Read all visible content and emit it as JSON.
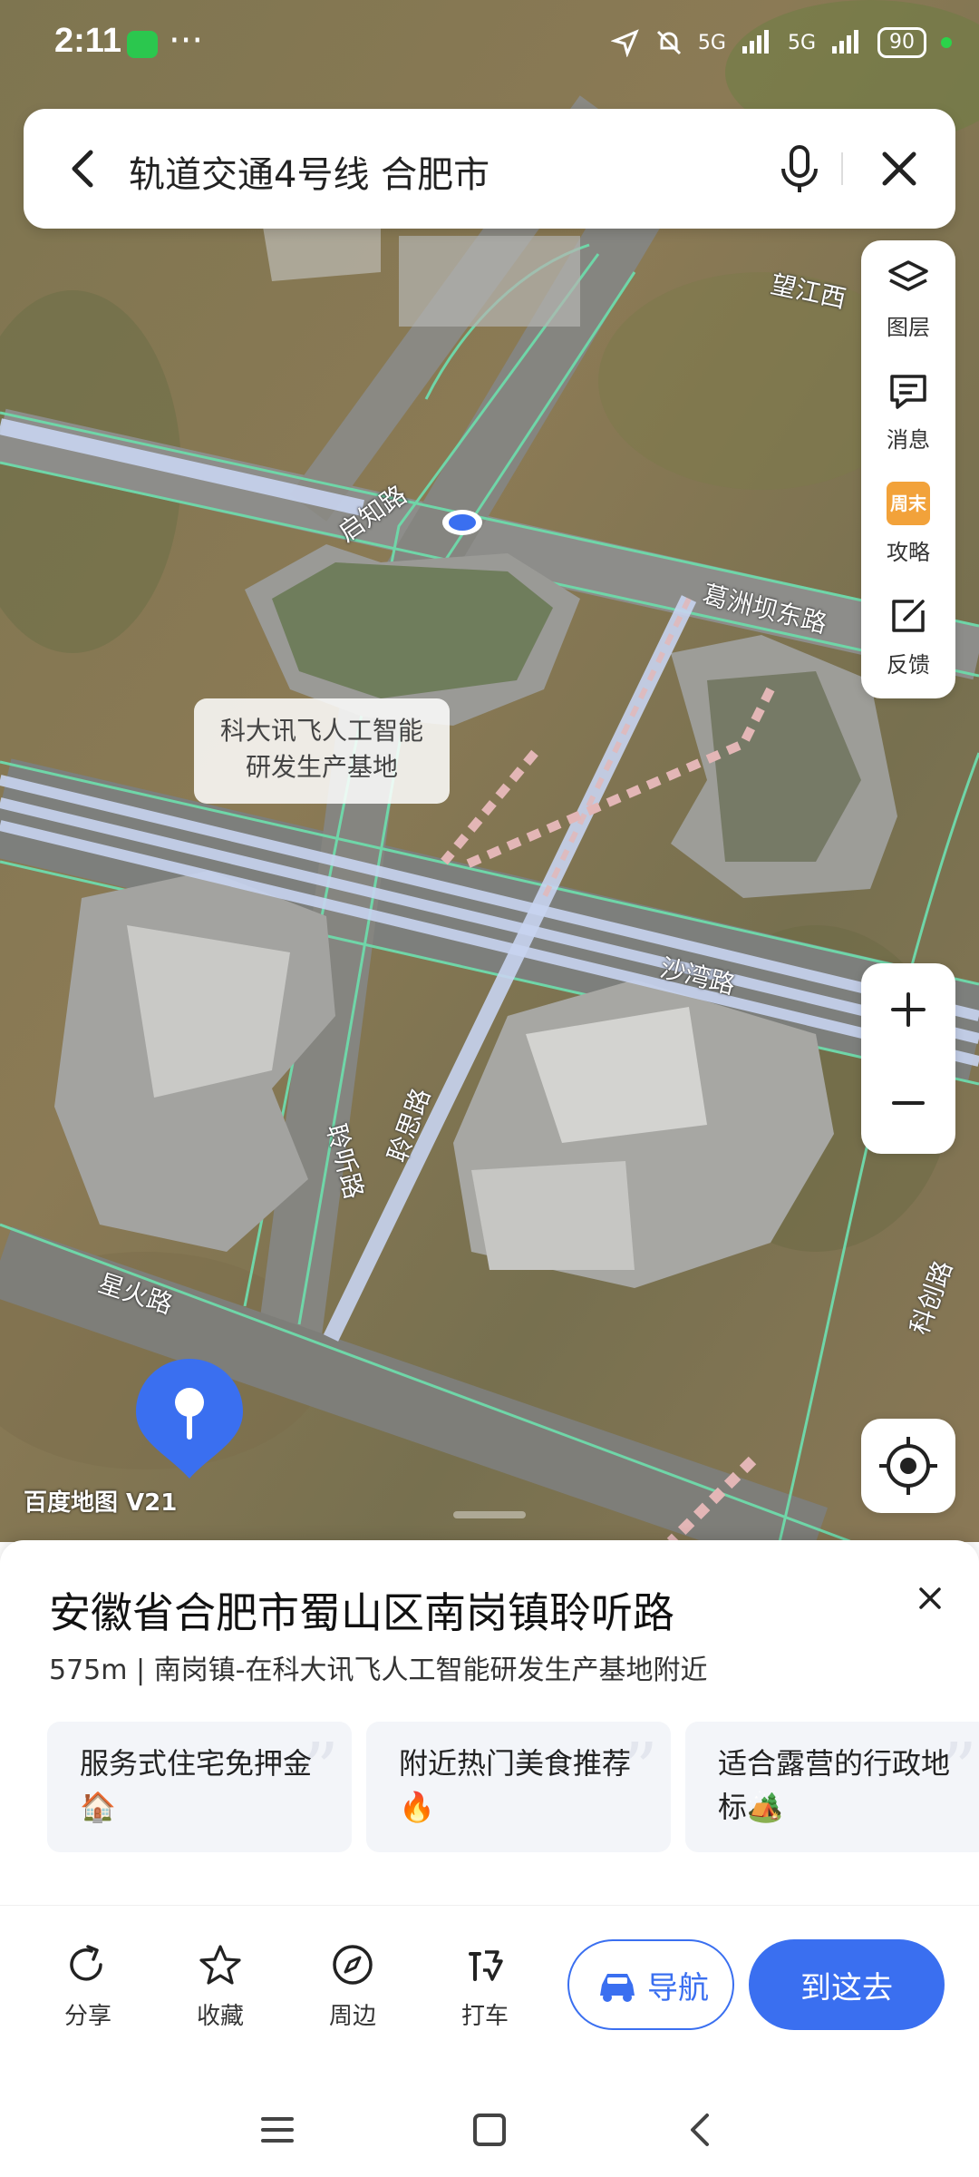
{
  "status_bar": {
    "time": "2:11",
    "dots": "···",
    "net1": "5G",
    "net2": "5G",
    "battery": "90"
  },
  "search": {
    "query": "轨道交通4号线 合肥市"
  },
  "tools": [
    {
      "label": "图层",
      "icon": "layers-icon"
    },
    {
      "label": "消息",
      "icon": "message-icon"
    },
    {
      "label": "攻略",
      "icon": "weekend-badge-icon",
      "badge": "周末"
    },
    {
      "label": "反馈",
      "icon": "feedback-icon"
    }
  ],
  "map": {
    "poi_label": {
      "line1": "科大讯飞人工智能",
      "line2": "研发生产基地"
    },
    "roads": [
      "望江西",
      "启知路",
      "葛洲坝东路",
      "沙湾路",
      "聆听路",
      "聆思路",
      "星火路",
      "科创路"
    ],
    "watermark": "百度地图 V21"
  },
  "zoom": {
    "in": "+",
    "out": "−"
  },
  "sheet": {
    "address": "安徽省合肥市蜀山区南岗镇聆听路",
    "distance": "575m",
    "detail": "南岗镇-在科大讯飞人工智能研发生产基地附近",
    "cards": [
      {
        "text": "服务式住宅免押金🏠"
      },
      {
        "text": "附近热门美食推荐🔥"
      },
      {
        "text": "适合露营的行政地标🏕️"
      }
    ]
  },
  "actions": [
    {
      "label": "分享",
      "icon": "share-icon"
    },
    {
      "label": "收藏",
      "icon": "star-icon"
    },
    {
      "label": "周边",
      "icon": "compass-icon"
    },
    {
      "label": "打车",
      "icon": "taxi-icon"
    }
  ],
  "nav_button": "导航",
  "go_button": "到这去",
  "colors": {
    "accent": "#3a6ff0",
    "road_green": "#6fd6a8",
    "metro": "#c8d4f0"
  }
}
